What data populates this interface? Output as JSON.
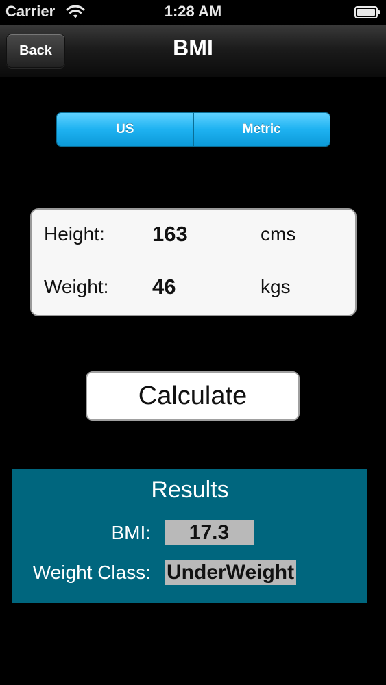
{
  "status_bar": {
    "carrier": "Carrier",
    "time": "1:28 AM",
    "icons": [
      "wifi-icon",
      "battery-icon"
    ]
  },
  "nav": {
    "back_label": "Back",
    "title": "BMI"
  },
  "unit_toggle": {
    "options": [
      "US",
      "Metric"
    ],
    "color": "#1eb2f1"
  },
  "inputs": {
    "height": {
      "label": "Height:",
      "value": "163",
      "unit": "cms"
    },
    "weight": {
      "label": "Weight:",
      "value": "46",
      "unit": "kgs"
    }
  },
  "calculate_label": "Calculate",
  "results": {
    "title": "Results",
    "bmi_label": "BMI:",
    "bmi_value": "17.3",
    "class_label": "Weight Class:",
    "class_value": "UnderWeight",
    "panel_color": "#00667e"
  }
}
